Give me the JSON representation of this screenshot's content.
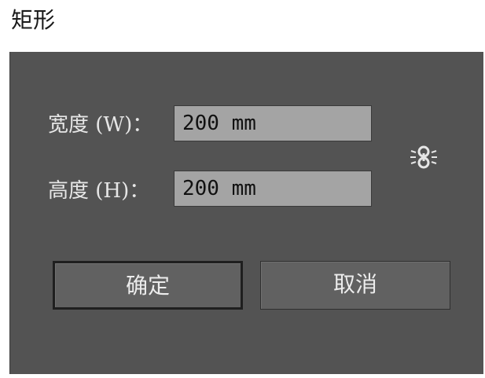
{
  "window": {
    "title": "矩形"
  },
  "form": {
    "width_label": "宽度 (W)：",
    "width_value": "200 mm",
    "height_label": "高度 (H)：",
    "height_value": "200 mm",
    "constrain_icon": "link-icon"
  },
  "buttons": {
    "ok_label": "确定",
    "cancel_label": "取消"
  },
  "colors": {
    "dialog_bg": "#535353",
    "input_bg": "#a4a4a4",
    "button_bg": "#616161"
  }
}
